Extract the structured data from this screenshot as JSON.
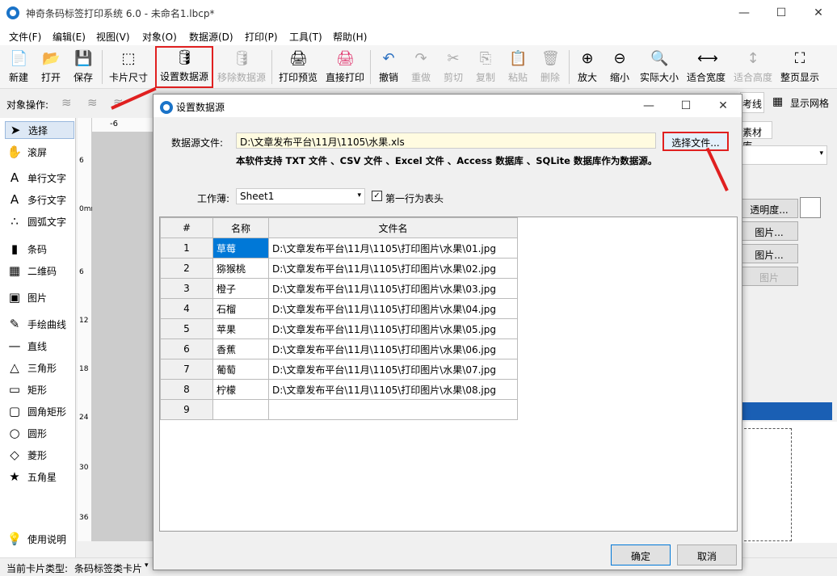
{
  "window": {
    "title": "神奇条码标签打印系统 6.0 - 未命名1.lbcp*",
    "minimize": "—",
    "maximize": "☐",
    "close": "✕"
  },
  "menu": [
    "文件(F)",
    "编辑(E)",
    "视图(V)",
    "对象(O)",
    "数据源(D)",
    "打印(P)",
    "工具(T)",
    "帮助(H)"
  ],
  "toolbar": [
    {
      "label": "新建",
      "icon": "📄"
    },
    {
      "label": "打开",
      "icon": "📂"
    },
    {
      "label": "保存",
      "icon": "💾"
    },
    {
      "label": "卡片尺寸",
      "icon": "⬚"
    },
    {
      "label": "设置数据源",
      "icon": "🛢"
    },
    {
      "label": "移除数据源",
      "icon": "🛢"
    },
    {
      "label": "打印预览",
      "icon": "🖨"
    },
    {
      "label": "直接打印",
      "icon": "🖨"
    },
    {
      "label": "撤销",
      "icon": "↶"
    },
    {
      "label": "重做",
      "icon": "↷"
    },
    {
      "label": "剪切",
      "icon": "✂"
    },
    {
      "label": "复制",
      "icon": "⎘"
    },
    {
      "label": "粘贴",
      "icon": "📋"
    },
    {
      "label": "删除",
      "icon": "🗑"
    },
    {
      "label": "放大",
      "icon": "⊕"
    },
    {
      "label": "缩小",
      "icon": "⊖"
    },
    {
      "label": "实际大小",
      "icon": "🔍"
    },
    {
      "label": "适合宽度",
      "icon": "⟷"
    },
    {
      "label": "适合高度",
      "icon": "↕"
    },
    {
      "label": "整页显示",
      "icon": "⛶"
    }
  ],
  "objbar": {
    "label": "对象操作:"
  },
  "leftpanel": [
    {
      "label": "选择",
      "icon": "➤"
    },
    {
      "label": "滚屏",
      "icon": "✋"
    },
    {
      "label": "单行文字",
      "icon": "A"
    },
    {
      "label": "多行文字",
      "icon": "A"
    },
    {
      "label": "圆弧文字",
      "icon": "∴"
    },
    {
      "label": "条码",
      "icon": "▮"
    },
    {
      "label": "二维码",
      "icon": "▦"
    },
    {
      "label": "图片",
      "icon": "▣"
    },
    {
      "label": "手绘曲线",
      "icon": "✎"
    },
    {
      "label": "直线",
      "icon": "—"
    },
    {
      "label": "三角形",
      "icon": "△"
    },
    {
      "label": "矩形",
      "icon": "▭"
    },
    {
      "label": "圆角矩形",
      "icon": "▢"
    },
    {
      "label": "圆形",
      "icon": "○"
    },
    {
      "label": "菱形",
      "icon": "◇"
    },
    {
      "label": "五角星",
      "icon": "★"
    },
    {
      "label": "使用说明",
      "icon": "💡"
    }
  ],
  "ruler": {
    "h": "-6",
    "v": [
      "6",
      "0mm",
      "6",
      "12",
      "18",
      "24",
      "30",
      "36"
    ]
  },
  "rightpanel": {
    "tab1": "考线",
    "grid": "显示网格",
    "tab2": "素材库",
    "b1": "透明度...",
    "b2": "图片...",
    "b3": "图片...",
    "b4": "图片"
  },
  "statusbar": {
    "label": "当前卡片类型:",
    "value": "条码标签类卡片"
  },
  "dialog": {
    "title": "设置数据源",
    "source_label": "数据源文件:",
    "source_value": "D:\\文章发布平台\\11月\\1105\\水果.xls",
    "choose_button": "选择文件...",
    "support_text": "本软件支持 TXT 文件 、CSV 文件 、Excel 文件 、Access 数据库 、SQLite 数据库作为数据源。",
    "sheet_label": "工作薄:",
    "sheet_value": "Sheet1",
    "header_check": "第一行为表头",
    "columns": [
      "#",
      "名称",
      "文件名"
    ],
    "rows": [
      [
        "1",
        "草莓",
        "D:\\文章发布平台\\11月\\1105\\打印图片\\水果\\01.jpg"
      ],
      [
        "2",
        "猕猴桃",
        "D:\\文章发布平台\\11月\\1105\\打印图片\\水果\\02.jpg"
      ],
      [
        "3",
        "橙子",
        "D:\\文章发布平台\\11月\\1105\\打印图片\\水果\\03.jpg"
      ],
      [
        "4",
        "石榴",
        "D:\\文章发布平台\\11月\\1105\\打印图片\\水果\\04.jpg"
      ],
      [
        "5",
        "苹果",
        "D:\\文章发布平台\\11月\\1105\\打印图片\\水果\\05.jpg"
      ],
      [
        "6",
        "香蕉",
        "D:\\文章发布平台\\11月\\1105\\打印图片\\水果\\06.jpg"
      ],
      [
        "7",
        "葡萄",
        "D:\\文章发布平台\\11月\\1105\\打印图片\\水果\\07.jpg"
      ],
      [
        "8",
        "柠檬",
        "D:\\文章发布平台\\11月\\1105\\打印图片\\水果\\08.jpg"
      ],
      [
        "9",
        "",
        ""
      ]
    ],
    "ok": "确定",
    "cancel": "取消"
  }
}
